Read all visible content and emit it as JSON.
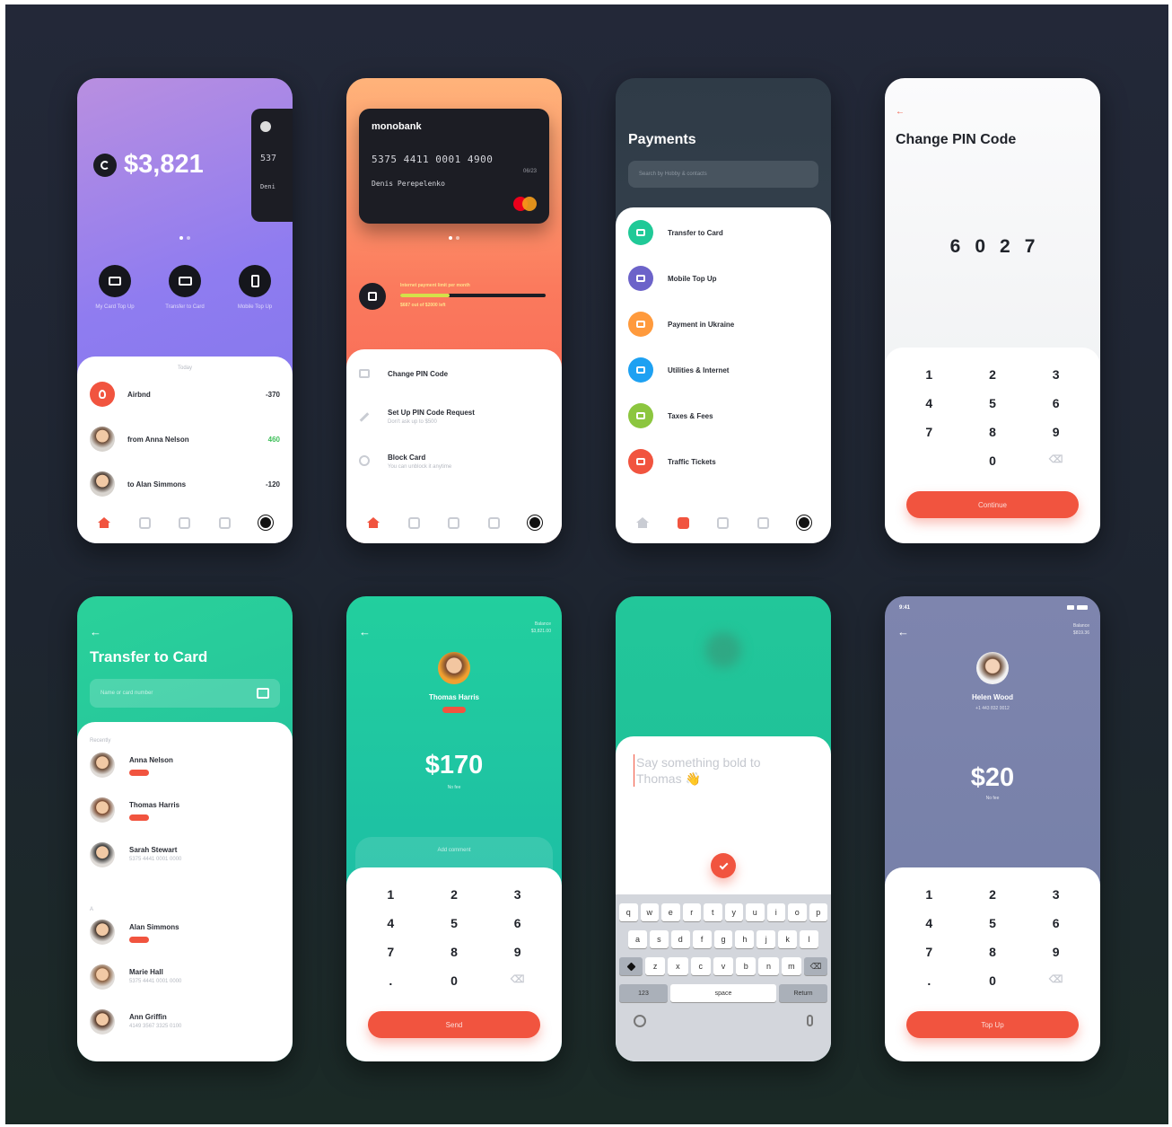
{
  "screen1": {
    "balance": "$3,821",
    "card_peek_num": "537",
    "card_peek_name": "Deni",
    "actions": [
      {
        "label": "My Card Top Up",
        "icon": "card-topup-icon"
      },
      {
        "label": "Transfer to Card",
        "icon": "transfer-icon"
      },
      {
        "label": "Mobile Top Up",
        "icon": "mobile-icon"
      }
    ],
    "section": "Today",
    "transactions": [
      {
        "name": "Airbnd",
        "amount": "-370",
        "color": "#2a2d35"
      },
      {
        "name": "from Anna Nelson",
        "amount": "460",
        "color": "#3fbf5a"
      },
      {
        "name": "to Alan Simmons",
        "amount": "-120",
        "color": "#2a2d35"
      }
    ]
  },
  "screen2": {
    "bank": "monobank",
    "card_number": "5375 4411 0001 4900",
    "expiry": "06/23",
    "holder": "Denis Perepelenko",
    "limit_label": "Internet payment limit per month",
    "limit_value": "$687 out of $2000 left",
    "limit_progress": 0.34,
    "menu": [
      {
        "title": "Change PIN Code",
        "sub": ""
      },
      {
        "title": "Set Up PIN Code Request",
        "sub": "Don't ask up to $500"
      },
      {
        "title": "Block Card",
        "sub": "You can unblock it anytime"
      }
    ]
  },
  "screen3": {
    "title": "Payments",
    "search_placeholder": "Search by Hobby & contacts",
    "items": [
      {
        "label": "Transfer to Card",
        "color": "#20c997",
        "icon": "card-icon"
      },
      {
        "label": "Mobile Top Up",
        "color": "#6c63c9",
        "icon": "phone-icon"
      },
      {
        "label": "Payment in Ukraine",
        "color": "#ff9a3c",
        "icon": "payment-icon"
      },
      {
        "label": "Utilities & Internet",
        "color": "#1ea1f2",
        "icon": "home-icon"
      },
      {
        "label": "Taxes & Fees",
        "color": "#8cc63f",
        "icon": "bag-icon"
      },
      {
        "label": "Traffic Tickets",
        "color": "#f1543f",
        "icon": "car-icon"
      }
    ]
  },
  "screen4": {
    "back": "←",
    "title": "Change PIN Code",
    "pin": [
      "6",
      "0",
      "2",
      "7"
    ],
    "keys": [
      "1",
      "2",
      "3",
      "4",
      "5",
      "6",
      "7",
      "8",
      "9",
      "",
      "0",
      "⌫"
    ],
    "button": "Continue"
  },
  "screen5": {
    "back": "←",
    "title": "Transfer to Card",
    "search_placeholder": "Name or card number",
    "section_recent": "Recently",
    "section_letter": "A",
    "contacts": [
      {
        "name": "Anna Nelson",
        "sub": "",
        "badge": true
      },
      {
        "name": "Thomas Harris",
        "sub": "",
        "badge": true
      },
      {
        "name": "Sarah Stewart",
        "sub": "5375 4441 0001 0000",
        "badge": false
      },
      {
        "name": "Alan Simmons",
        "sub": "",
        "badge": true
      },
      {
        "name": "Marie Hall",
        "sub": "5375 4441 0001 0000",
        "badge": false
      },
      {
        "name": "Ann Griffin",
        "sub": "4149 3567 3325 0100",
        "badge": false
      }
    ]
  },
  "screen6": {
    "back": "←",
    "top_right": [
      "Balance",
      "$3,821.00"
    ],
    "name": "Thomas Harris",
    "amount": "$170",
    "fee": "No fee",
    "comment": "Add comment",
    "keys": [
      "1",
      "2",
      "3",
      "4",
      "5",
      "6",
      "7",
      "8",
      "9",
      ".",
      "0",
      "⌫"
    ],
    "button": "Send"
  },
  "screen7": {
    "message": "Say something bold to Thomas 👋",
    "keyboard": {
      "row1": [
        "q",
        "w",
        "e",
        "r",
        "t",
        "y",
        "u",
        "i",
        "o",
        "p"
      ],
      "row2": [
        "a",
        "s",
        "d",
        "f",
        "g",
        "h",
        "j",
        "k",
        "l"
      ],
      "row3": [
        "z",
        "x",
        "c",
        "v",
        "b",
        "n",
        "m"
      ],
      "bottom": [
        "123",
        "space",
        "Return"
      ]
    }
  },
  "screen8": {
    "status_time": "9:41",
    "back": "←",
    "top_right": [
      "Balance",
      "$819.36"
    ],
    "name": "Helen Wood",
    "phone": "+1 443 832 0012",
    "amount": "$20",
    "fee": "No fee",
    "keys": [
      "1",
      "2",
      "3",
      "4",
      "5",
      "6",
      "7",
      "8",
      "9",
      ".",
      "0",
      "⌫"
    ],
    "button": "Top Up"
  },
  "colors": {
    "accent": "#f1543f",
    "teal": "#1ec8a0",
    "purple": "#8a78e8",
    "slate": "#7b85a8"
  }
}
